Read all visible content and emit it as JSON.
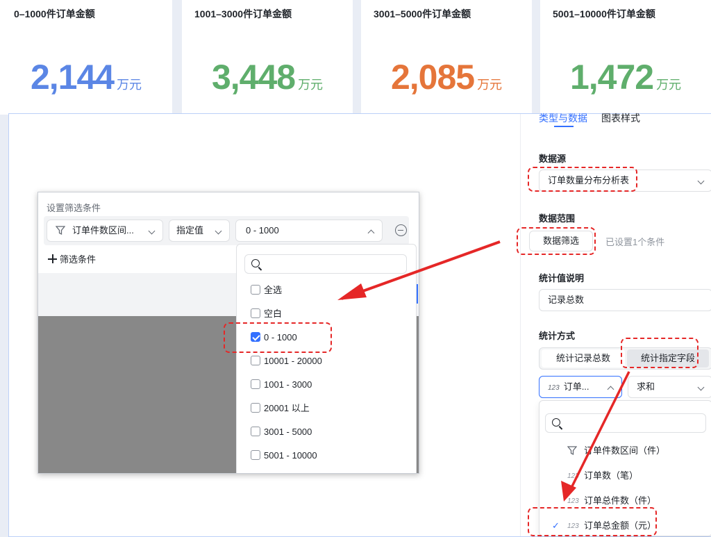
{
  "kpis": [
    {
      "title": "0–1000件订单金额",
      "value": "2,144",
      "unit": "万元",
      "color": "#5b86e5"
    },
    {
      "title": "1001–3000件订单金额",
      "value": "3,448",
      "unit": "万元",
      "color": "#5fae6c"
    },
    {
      "title": "3001–5000件订单金额",
      "value": "2,085",
      "unit": "万元",
      "color": "#e5753a"
    },
    {
      "title": "5001–10000件订单金额",
      "value": "1,472",
      "unit": "万元",
      "color": "#5fae6c"
    }
  ],
  "right_panel": {
    "tabs": [
      "类型与数据",
      "图表样式"
    ],
    "data_source": {
      "label": "数据源",
      "value": "订单数量分布分析表"
    },
    "data_range": {
      "label": "数据范围",
      "button": "数据筛选",
      "status": "已设置1个条件"
    },
    "stat_desc": {
      "label": "统计值说明",
      "value": "记录总数"
    },
    "stat_method": {
      "label": "统计方式",
      "options": [
        "统计记录总数",
        "统计指定字段"
      ],
      "selected": "统计指定字段"
    },
    "field_select": {
      "icon": "123",
      "value": "订单..."
    },
    "agg_select": {
      "value": "求和"
    },
    "field_options": [
      {
        "icon": "filter-field",
        "label": "订单件数区间（件）",
        "checked": false
      },
      {
        "icon": "123",
        "label": "订单数（笔）",
        "checked": false
      },
      {
        "icon": "123",
        "label": "订单总件数（件）",
        "checked": false
      },
      {
        "icon": "123",
        "label": "订单总金额（元）",
        "checked": true
      }
    ],
    "check_mark": "✓"
  },
  "filter_dialog": {
    "title": "设置筛选条件",
    "field": "订单件数区间...",
    "operator": "指定值",
    "value": "0 - 1000",
    "add_condition": "筛选条件",
    "options": [
      {
        "label": "全选",
        "checked": false
      },
      {
        "label": "空白",
        "checked": false
      },
      {
        "label": "0 - 1000",
        "checked": true
      },
      {
        "label": "10001 - 20000",
        "checked": false
      },
      {
        "label": "1001 - 3000",
        "checked": false
      },
      {
        "label": "20001 以上",
        "checked": false
      },
      {
        "label": "3001 - 5000",
        "checked": false
      },
      {
        "label": "5001 - 10000",
        "checked": false
      }
    ]
  },
  "colors": {
    "accent": "#3370ff",
    "annotation": "#e52727"
  }
}
